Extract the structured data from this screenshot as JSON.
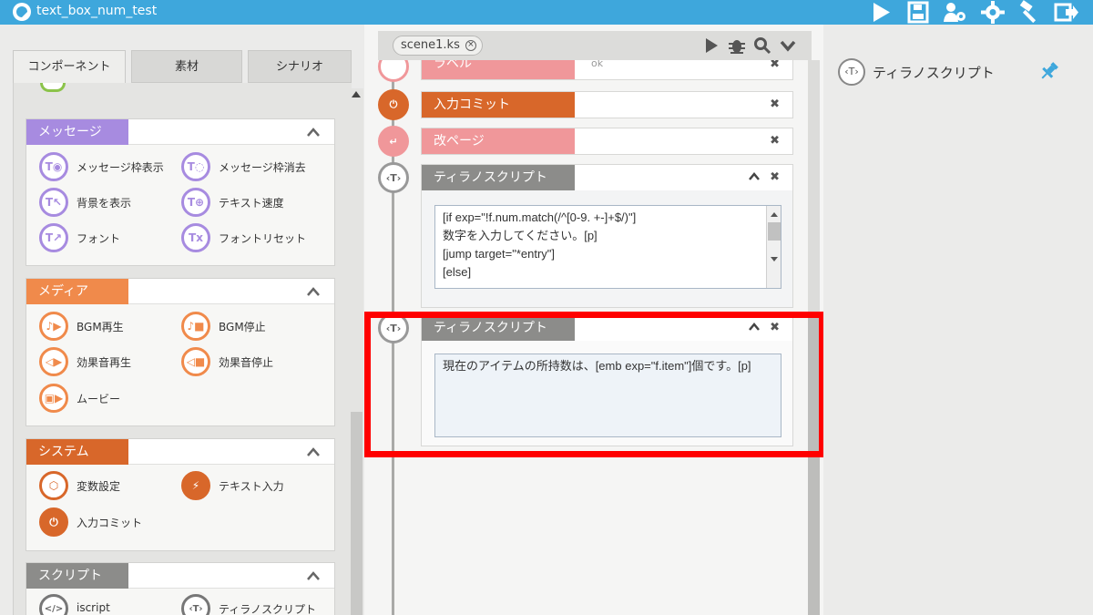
{
  "app": {
    "title": "text_box_num_test"
  },
  "toolbar_icons": [
    "play-icon",
    "save-icon",
    "users-gear-icon",
    "gear-icon",
    "hammer-icon",
    "exit-icon"
  ],
  "left_tabs": [
    {
      "label": "コンポーネント",
      "active": true
    },
    {
      "label": "素材",
      "active": false
    },
    {
      "label": "シナリオ",
      "active": false
    }
  ],
  "groups": {
    "message": {
      "label": "メッセージ",
      "color": "#a78be0",
      "items": [
        "メッセージ枠表示",
        "メッセージ枠消去",
        "背景を表示",
        "テキスト速度",
        "フォント",
        "フォントリセット"
      ]
    },
    "media": {
      "label": "メディア",
      "color": "#f08a4b",
      "items": [
        "BGM再生",
        "BGM停止",
        "効果音再生",
        "効果音停止",
        "ムービー"
      ]
    },
    "system": {
      "label": "システム",
      "color": "#d8672a",
      "items": [
        "変数設定",
        "テキスト入力",
        "入力コミット"
      ]
    },
    "script": {
      "label": "スクリプト",
      "color": "#8c8c8a",
      "items": [
        "iscript",
        "ティラノスクリプト"
      ]
    }
  },
  "scene": {
    "tab_label": "scene1.ks"
  },
  "blocks": {
    "partial_label": "ラベル",
    "partial_value": "ok",
    "commit": {
      "label": "入力コミット",
      "color": "#d8672a"
    },
    "page": {
      "label": "改ページ",
      "color": "#f0979a"
    },
    "tyrano1": {
      "label": "ティラノスクリプト",
      "lines": [
        "[if exp=\"!f.num.match(/^[0-9. +-]+$/)\"]",
        "数字を入力してください。[p]",
        "[jump target=\"*entry\"]",
        "[else]"
      ]
    },
    "tyrano2": {
      "label": "ティラノスクリプト",
      "text": "現在のアイテムの所持数は、[emb exp=\"f.item\"]個です。[p]"
    }
  },
  "right_panel": {
    "title": "ティラノスクリプト",
    "pin_icon": "pin-icon"
  },
  "colors": {
    "titlebar": "#3ea7dc",
    "highlight": "#ff0000"
  }
}
